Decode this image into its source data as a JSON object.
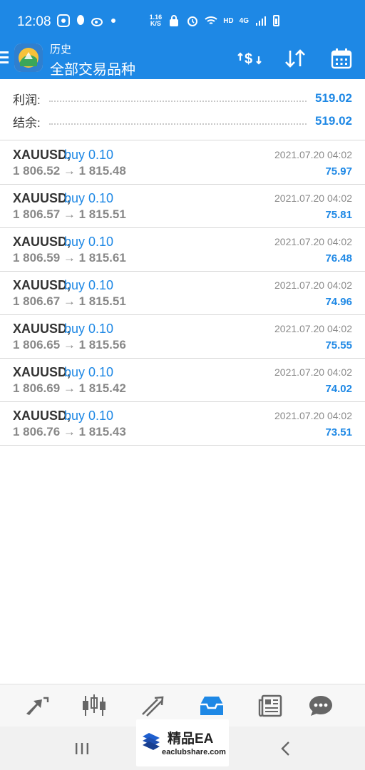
{
  "status_bar": {
    "time": "12:08",
    "net_speed_value": "1.16",
    "net_speed_unit": "K/S",
    "hd_label": "HD",
    "network_label": "4G"
  },
  "toolbar": {
    "subtitle": "历史",
    "title": "全部交易品种"
  },
  "summary": {
    "profit_label": "利润:",
    "profit_value": "519.02",
    "balance_label": "结余:",
    "balance_value": "519.02"
  },
  "trades": [
    {
      "symbol": "XAUUSD,",
      "action": "buy 0.10",
      "prices": "1 806.52 → 1 815.48",
      "date": "2021.07.20 04:02",
      "profit": "75.97"
    },
    {
      "symbol": "XAUUSD,",
      "action": "buy 0.10",
      "prices": "1 806.57 → 1 815.51",
      "date": "2021.07.20 04:02",
      "profit": "75.81"
    },
    {
      "symbol": "XAUUSD,",
      "action": "buy 0.10",
      "prices": "1 806.59 → 1 815.61",
      "date": "2021.07.20 04:02",
      "profit": "76.48"
    },
    {
      "symbol": "XAUUSD,",
      "action": "buy 0.10",
      "prices": "1 806.67 → 1 815.51",
      "date": "2021.07.20 04:02",
      "profit": "74.96"
    },
    {
      "symbol": "XAUUSD,",
      "action": "buy 0.10",
      "prices": "1 806.65 → 1 815.56",
      "date": "2021.07.20 04:02",
      "profit": "75.55"
    },
    {
      "symbol": "XAUUSD,",
      "action": "buy 0.10",
      "prices": "1 806.69 → 1 815.42",
      "date": "2021.07.20 04:02",
      "profit": "74.02"
    },
    {
      "symbol": "XAUUSD,",
      "action": "buy 0.10",
      "prices": "1 806.76 → 1 815.43",
      "date": "2021.07.20 04:02",
      "profit": "73.51"
    }
  ],
  "bottom_nav": [
    "quotes-icon",
    "chart-icon",
    "trade-icon",
    "history-icon",
    "news-icon",
    "chat-icon"
  ],
  "watermark": {
    "title": "精品EA",
    "url": "eaclubshare.com"
  },
  "colors": {
    "primary": "#1e88e5",
    "text": "#333333",
    "muted": "#888888",
    "divider": "#d7d7d7"
  }
}
